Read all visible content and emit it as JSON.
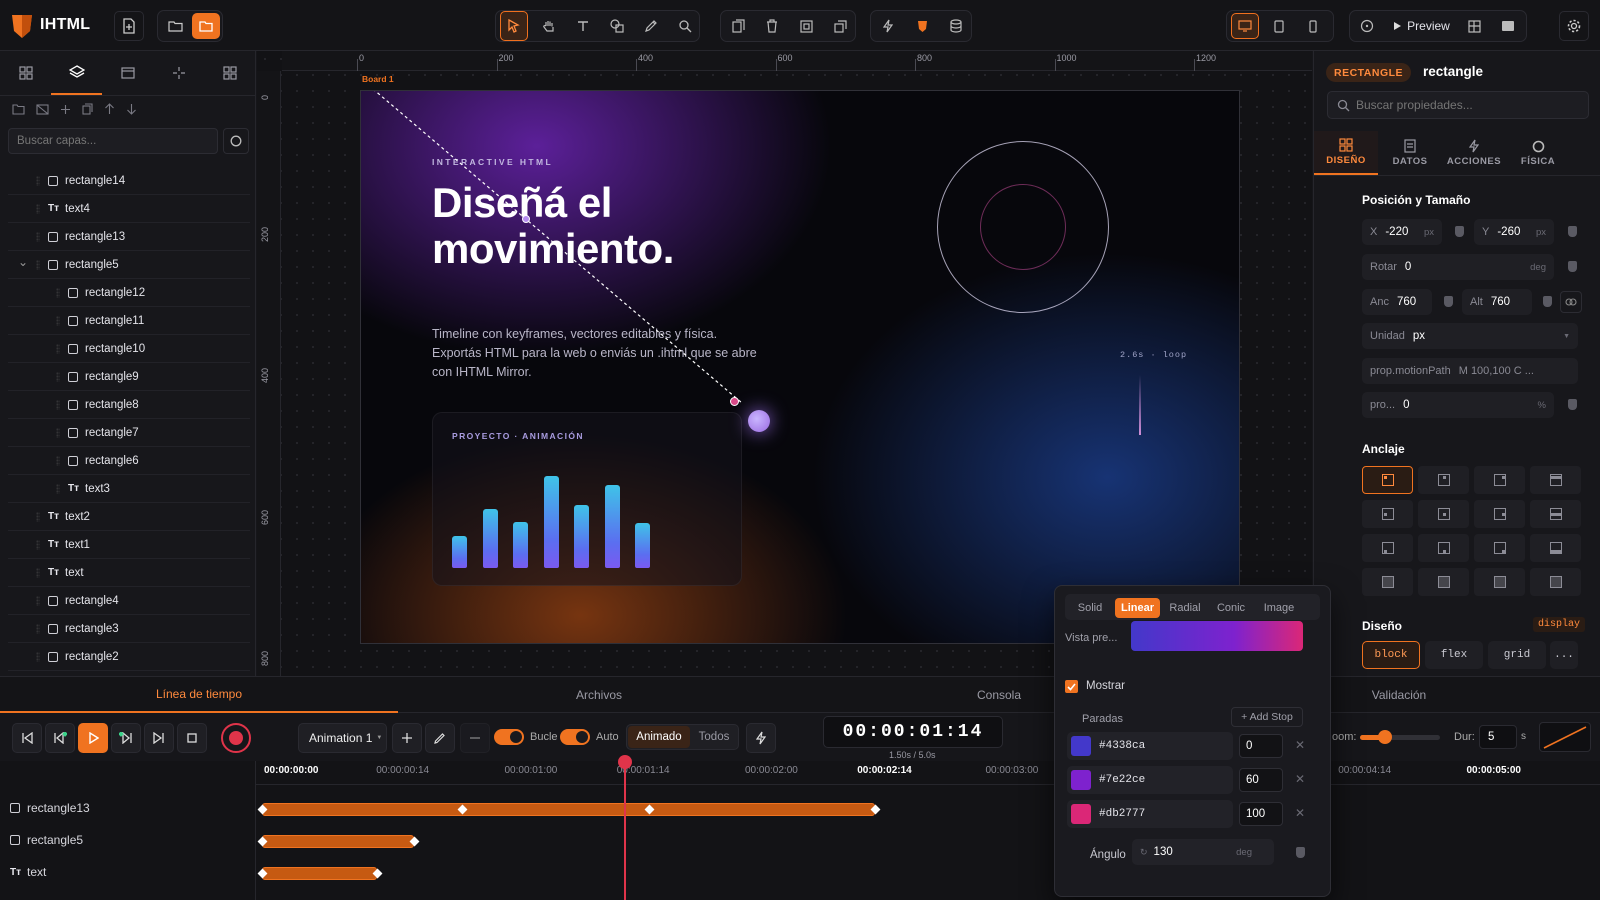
{
  "app": {
    "name": "IHTML",
    "accent": "#f07320"
  },
  "toolbar": {
    "preview_label": "Preview"
  },
  "left_panel": {
    "search_placeholder": "Buscar capas...",
    "layers": [
      {
        "name": "rectangle14",
        "type": "rect",
        "depth": 1
      },
      {
        "name": "text4",
        "type": "text",
        "depth": 1
      },
      {
        "name": "rectangle13",
        "type": "rect",
        "depth": 1
      },
      {
        "name": "rectangle5",
        "type": "rect",
        "depth": 1,
        "expanded": true
      },
      {
        "name": "rectangle12",
        "type": "rect",
        "depth": 2
      },
      {
        "name": "rectangle11",
        "type": "rect",
        "depth": 2
      },
      {
        "name": "rectangle10",
        "type": "rect",
        "depth": 2
      },
      {
        "name": "rectangle9",
        "type": "rect",
        "depth": 2
      },
      {
        "name": "rectangle8",
        "type": "rect",
        "depth": 2
      },
      {
        "name": "rectangle7",
        "type": "rect",
        "depth": 2
      },
      {
        "name": "rectangle6",
        "type": "rect",
        "depth": 2
      },
      {
        "name": "text3",
        "type": "text",
        "depth": 2
      },
      {
        "name": "text2",
        "type": "text",
        "depth": 1
      },
      {
        "name": "text1",
        "type": "text",
        "depth": 1
      },
      {
        "name": "text",
        "type": "text",
        "depth": 1
      },
      {
        "name": "rectangle4",
        "type": "rect",
        "depth": 1
      },
      {
        "name": "rectangle3",
        "type": "rect",
        "depth": 1
      },
      {
        "name": "rectangle2",
        "type": "rect",
        "depth": 1
      }
    ]
  },
  "canvas": {
    "ruler_h": [
      "0",
      "200",
      "400",
      "600",
      "800",
      "1000",
      "1200"
    ],
    "ruler_v": [
      "0",
      "200",
      "400",
      "600",
      "800"
    ],
    "board_label": "Board 1",
    "eyebrow": "INTERACTIVE HTML",
    "headline_1": "Diseñá el",
    "headline_2": "movimiento.",
    "body": "Timeline con keyframes, vectores editables y física. Exportás HTML para la web o enviás un .ihtml que se abre con IHTML Mirror.",
    "card_label": "PROYECTO · ANIMACIÓN",
    "bars": [
      0.35,
      0.64,
      0.5,
      1.0,
      0.68,
      0.9,
      0.49
    ],
    "loop_label": "2.6s · loop"
  },
  "right_panel": {
    "type_badge": "RECTANGLE",
    "element_name": "rectangle",
    "search_placeholder": "Buscar propiedades...",
    "tabs": [
      "DISEÑO",
      "DATOS",
      "ACCIONES",
      "FÍSICA"
    ],
    "section_pos": "Posición y Tamaño",
    "x_label": "X",
    "x_value": "-220",
    "y_label": "Y",
    "y_value": "-260",
    "px": "px",
    "rot_label": "Rotar",
    "rot_value": "0",
    "deg": "deg",
    "w_label": "Anc",
    "w_value": "760",
    "h_label": "Alt",
    "h_value": "760",
    "unit_label": "Unidad",
    "unit_value": "px",
    "path_label": "prop.motionPath",
    "path_value": "M 100,100 C ...",
    "pro_label": "pro...",
    "pro_value": "0",
    "pct": "%",
    "section_anchor": "Anclaje",
    "section_design": "Diseño",
    "display_badge": "display",
    "display_options": [
      "block",
      "flex",
      "grid",
      "..."
    ]
  },
  "bottom_tabs": [
    "Línea de tiempo",
    "Archivos",
    "Consola",
    "Validación"
  ],
  "transport": {
    "animation": "Animation 1",
    "loop_label": "Bucle",
    "auto_label": "Auto",
    "filter_animated": "Animado",
    "filter_all": "Todos",
    "timecode": "00:00:01:14",
    "time_sub": "1.50s / 5.0s",
    "zoom_label": "oom:",
    "dur_label": "Dur:",
    "dur_value": "5",
    "dur_unit": "s"
  },
  "timeline": {
    "ticks": [
      "00:00:00:00",
      "00:00:00:14",
      "00:00:01:00",
      "00:00:01:14",
      "00:00:02:00",
      "00:00:02:14",
      "00:00:03:00",
      "00:00:04:14",
      "00:00:05:00"
    ],
    "tracks": [
      "rectangle13",
      "rectangle5",
      "text"
    ],
    "playhead": 1.5
  },
  "gradient_popup": {
    "tabs": [
      "Solid",
      "Linear",
      "Radial",
      "Conic",
      "Image"
    ],
    "preview_label": "Vista pre...",
    "show_label": "Mostrar",
    "stops_label": "Paradas",
    "add_stop": "+ Add Stop",
    "stops": [
      {
        "color": "#4338ca",
        "position": "0"
      },
      {
        "color": "#7e22ce",
        "position": "60"
      },
      {
        "color": "#db2777",
        "position": "100"
      }
    ],
    "angle_label": "Ángulo",
    "angle_value": "130",
    "angle_unit": "deg"
  }
}
